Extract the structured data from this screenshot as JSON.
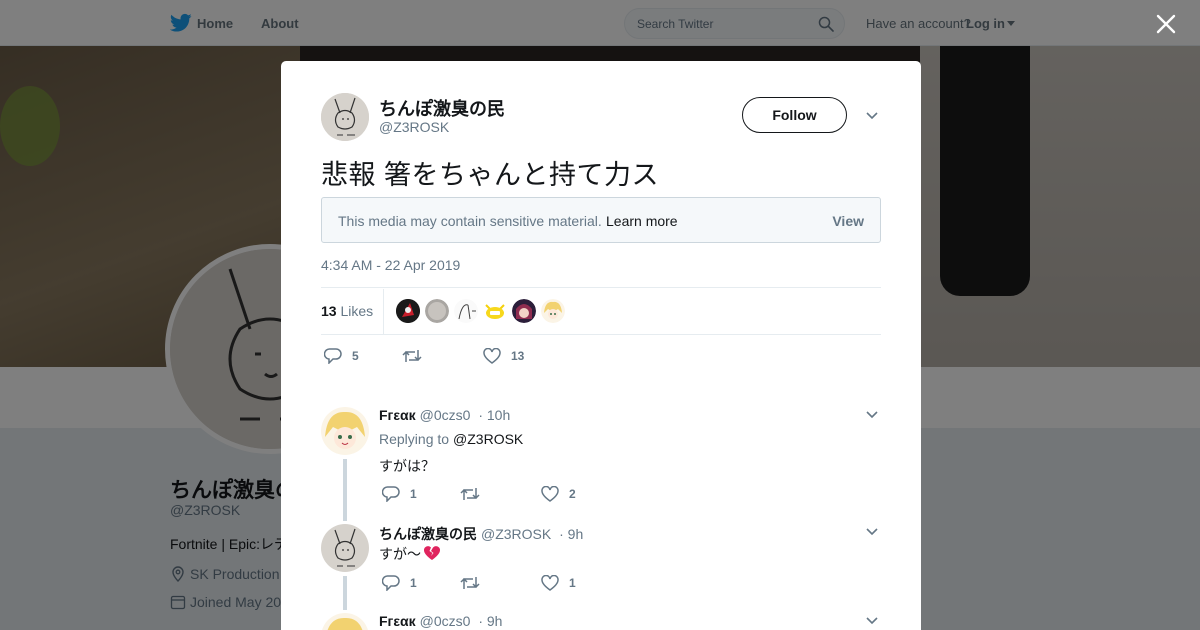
{
  "nav": {
    "home": "Home",
    "about": "About",
    "search_placeholder": "Search Twitter",
    "have_account": "Have an account?",
    "login": "Log in"
  },
  "profile": {
    "name": "ちんぽ激臭の民",
    "handle": "@Z3ROSK",
    "bio": "Fortnite | Epic:レデ",
    "location": "SK Production",
    "joined": "Joined May 20"
  },
  "tweet": {
    "author_name": "ちんぽ激臭の民",
    "author_handle": "@Z3ROSK",
    "follow_label": "Follow",
    "text": "悲報 箸をちゃんと持て力ス",
    "sensitive_text": "This media may contain sensitive material.",
    "learn_more": "Learn more",
    "view": "View",
    "timestamp": "4:34 AM - 22 Apr 2019",
    "likes_count": "13",
    "likes_label": "Likes",
    "replies": "5",
    "retweets": "",
    "likes": "13"
  },
  "replies": [
    {
      "name": "Fгεαк",
      "handle": "@0czs0",
      "time": "· 10h",
      "replying_label": "Replying to",
      "replying_to": "@Z3ROSK",
      "text": "すがは？",
      "replies": "1",
      "retweets": "",
      "likes": "2"
    },
    {
      "name": "ちんぽ激臭の民",
      "handle": "@Z3ROSK",
      "time": "· 9h",
      "text": "すが〜",
      "replies": "1",
      "retweets": "",
      "likes": "1"
    },
    {
      "name": "Fгεαк",
      "handle": "@0czs0",
      "time": "· 9h"
    }
  ],
  "colors": {
    "twitter_blue": "#1da1f2",
    "text_secondary": "#657786",
    "broken_heart": "#e0245e"
  }
}
